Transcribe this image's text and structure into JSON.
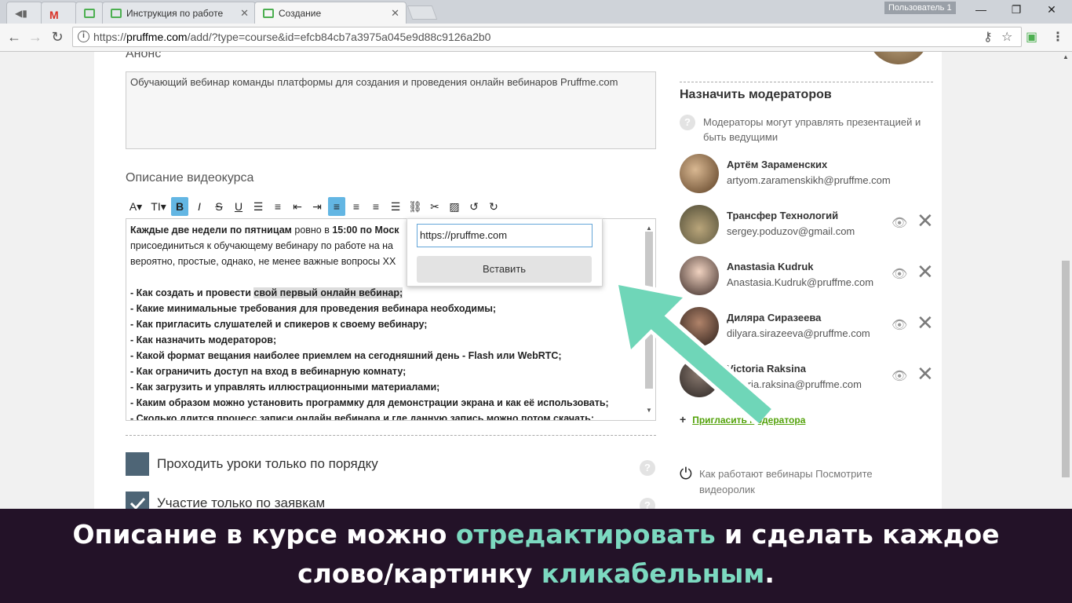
{
  "browser": {
    "tabs": [
      {
        "label": ""
      },
      {
        "label": ""
      },
      {
        "label": ""
      },
      {
        "label": "Инструкция по работе"
      },
      {
        "label": "Создание"
      }
    ],
    "user_badge": "Пользователь 1",
    "url_prefix": "https://",
    "url_host": "pruffme.com",
    "url_rest": "/add/?type=course&id=efcb84cb7a3975a045e9d88c9126a2b0"
  },
  "form": {
    "anons_label": "Анонс",
    "anons_text": "Обучающий вебинар команды платформы для создания и проведения онлайн вебинаров Pruffme.com",
    "description_label": "Описание видеокурса",
    "editor": {
      "line1_bold_a": "Каждые две недели по пятницам",
      "line1_plain_a": " ровно в ",
      "line1_bold_b": "15:00 по Моск",
      "line2": "присоединиться к обучающему вебинару по работе на на",
      "line3": "вероятно, простые, однако, не менее важные вопросы XX",
      "items": [
        {
          "text": "- Как создать и провести ",
          "highlight": "свой первый онлайн вебинар;"
        },
        {
          "text": "- Какие минимальные требования для проведения вебинара необходимы;"
        },
        {
          "text": "- Как пригласить слушателей и спикеров к своему вебинару;"
        },
        {
          "text": "- Как назначить модераторов;"
        },
        {
          "text": "- Какой формат вещания наиболее приемлем на сегодняшний день - Flash или WebRTC;"
        },
        {
          "text": "- Как ограничить доступ на вход в вебинарную комнату;"
        },
        {
          "text": "- Как загрузить и управлять иллюстрационными материалами;"
        },
        {
          "text": "- Каким образом можно установить программку для демонстрации экрана и как её использовать;"
        },
        {
          "text": "- Сколько длится процесс записи онлайн вебинара и где данную запись можно потом скачать;"
        }
      ],
      "trailing_char": "",
      "trailing_char_2": ","
    },
    "link_popup": {
      "url_value": "https://pruffme.com",
      "insert_button": "Вставить"
    },
    "options": [
      {
        "label": "Проходить уроки только по порядку",
        "checked": false
      },
      {
        "label": "Участие только по заявкам",
        "checked": true
      }
    ]
  },
  "moderators": {
    "title": "Назначить модераторов",
    "hint": "Модераторы могут управлять презентацией и быть ведущими",
    "list": [
      {
        "name": "Артём Зараменских",
        "email": "artyom.zaramenskikh@pruffme.com",
        "removable": false
      },
      {
        "name": "Трансфер Технологий",
        "email": "sergey.poduzov@gmail.com",
        "removable": true
      },
      {
        "name": "Anastasia Kudruk",
        "email": "Anastasia.Kudruk@pruffme.com",
        "removable": true
      },
      {
        "name": "Диляра Сиразеева",
        "email": "dilyara.sirazeeva@pruffme.com",
        "removable": true
      },
      {
        "name": "Victoria Raksina",
        "email": "victoria.raksina@pruffme.com",
        "removable": true
      }
    ],
    "invite_link": "Пригласить модератора",
    "how_it_works": "Как работают вебинары Посмотрите видеоролик"
  },
  "caption": {
    "part1": "Описание в курсе можно ",
    "accent1": "отредактировать",
    "part2": "  и сделать каждое",
    "part3": "слово/картинку ",
    "accent2": "кликабельным",
    "part4": "."
  },
  "colors": {
    "accent": "#63b6e3",
    "caption_bg": "#231228",
    "caption_accent": "#7cd9c0",
    "arrow": "#6fd6b8",
    "checkbox": "#4e6576"
  }
}
